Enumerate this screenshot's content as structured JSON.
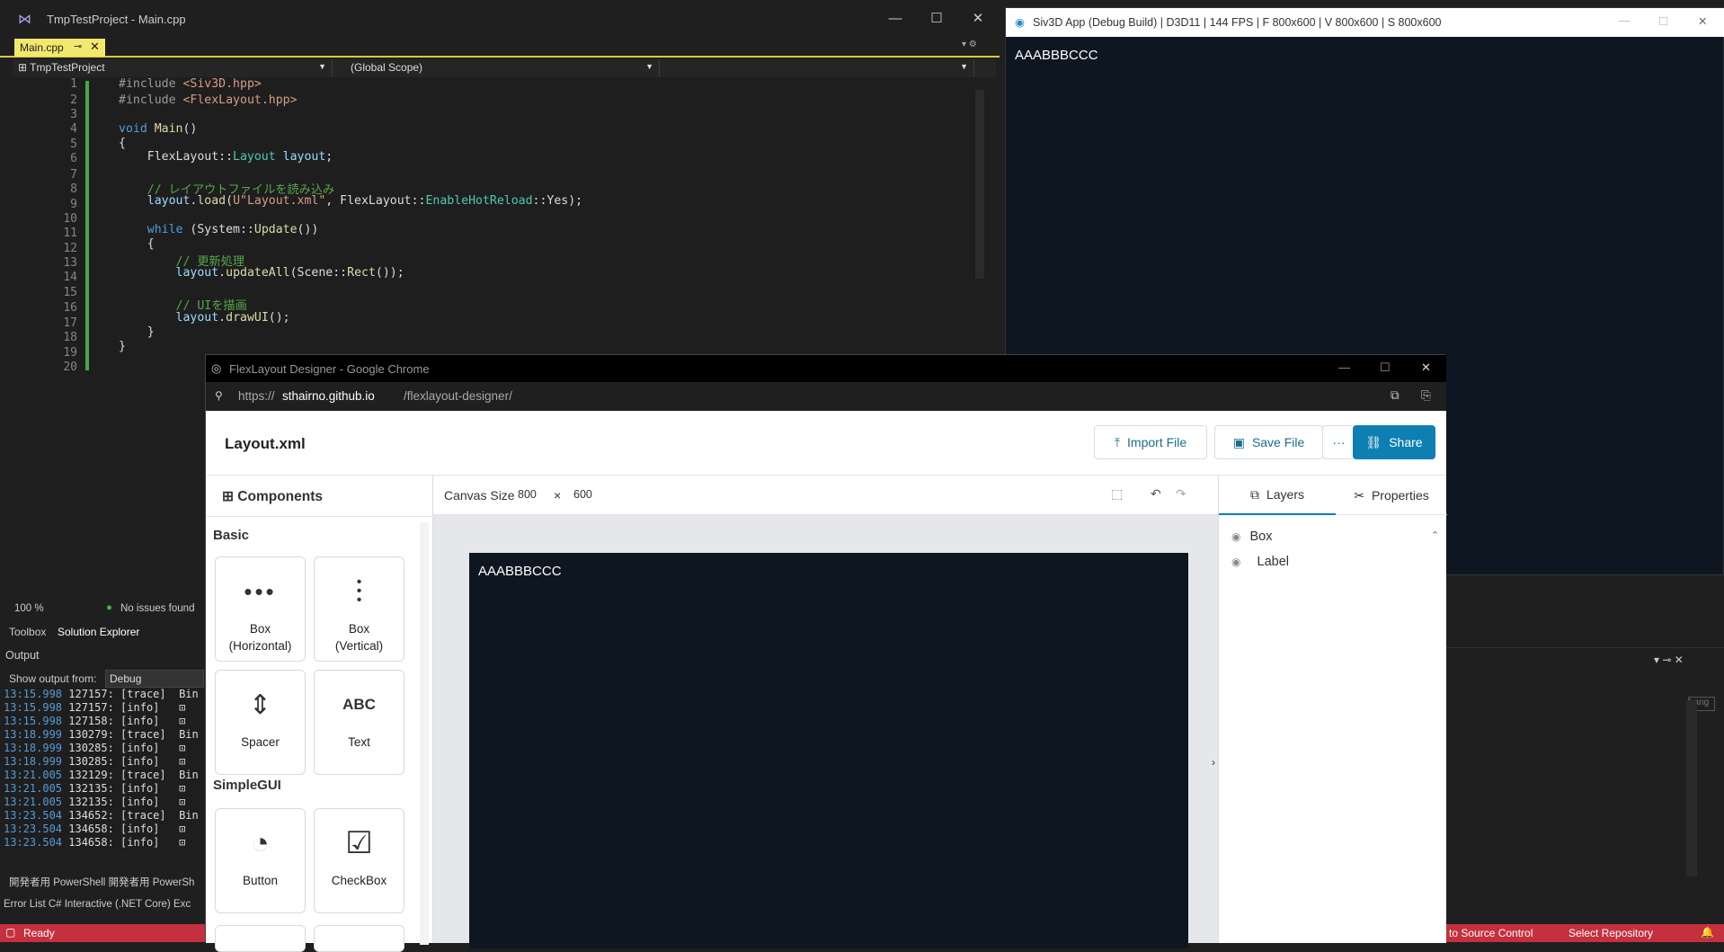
{
  "vs": {
    "title": "TmpTestProject - Main.cpp",
    "tab": "Main.cpp",
    "project_select": "TmpTestProject",
    "scope_select": "(Global Scope)",
    "zoom": "100 %",
    "issues": "No issues found",
    "dock_tab_toolbox": "Toolbox",
    "dock_tab_solution": "Solution Explorer",
    "output_title": "Output",
    "output_from_label": "Show output from:",
    "output_from_value": "Debug",
    "bottom_tabs_row1": "開発者用 PowerShell    開発者用 PowerSh",
    "bottom_tabs_row2": "Error List    C# Interactive (.NET Core)    Exc",
    "status_ready": "Ready",
    "status_source_control": "d to Source Control",
    "status_select_repo": "Select Repository",
    "code_lines": [
      "1",
      "2",
      "3",
      "4",
      "5",
      "6",
      "7",
      "8",
      "9",
      "10",
      "11",
      "12",
      "13",
      "14",
      "15",
      "16",
      "17",
      "18",
      "19",
      "20"
    ],
    "log": [
      [
        "13:15.998",
        "127157:",
        "[trace]",
        "Bin"
      ],
      [
        "13:15.998",
        "127157:",
        "[info]",
        "⊡"
      ],
      [
        "13:15.998",
        "127158:",
        "[info]",
        "⊡"
      ],
      [
        "13:18.999",
        "130279:",
        "[trace]",
        "Bin"
      ],
      [
        "13:18.999",
        "130285:",
        "[info]",
        "⊡"
      ],
      [
        "13:18.999",
        "130285:",
        "[info]",
        "⊡"
      ],
      [
        "13:21.005",
        "132129:",
        "[trace]",
        "Bin"
      ],
      [
        "13:21.005",
        "132135:",
        "[info]",
        "⊡"
      ],
      [
        "13:21.005",
        "132135:",
        "[info]",
        "⊡"
      ],
      [
        "13:23.504",
        "134652:",
        "[trace]",
        "Bin"
      ],
      [
        "13:23.504",
        "134658:",
        "[info]",
        "⊡"
      ],
      [
        "13:23.504",
        "134658:",
        "[info]",
        "⊡"
      ]
    ]
  },
  "siv": {
    "title": "Siv3D App (Debug Build) | D3D11 | 144 FPS | F 800x600 | V 800x600 | S 800x600",
    "text": "AAABBBCCC"
  },
  "chrome": {
    "title": "FlexLayout Designer - Google Chrome",
    "url_prefix": "https://",
    "url_host": "sthairno.github.io",
    "url_path": "/flexlayout-designer/"
  },
  "app": {
    "file_title": "Layout.xml",
    "import_label": "Import File",
    "save_label": "Save File",
    "more_label": "···",
    "share_label": "Share",
    "components_title": "Components",
    "section_basic": "Basic",
    "section_simplegui": "SimpleGUI",
    "cards": [
      {
        "label": "Box\n(Horizontal)"
      },
      {
        "label": "Box\n(Vertical)"
      },
      {
        "label": "Spacer"
      },
      {
        "label": "Text"
      },
      {
        "label": "Button"
      },
      {
        "label": "CheckBox"
      }
    ],
    "canvas_size_label": "Canvas Size",
    "canvas_w": "800",
    "canvas_x": "×",
    "canvas_h": "600",
    "canvas_text": "AAABBBCCC",
    "tab_layers": "Layers",
    "tab_properties": "Properties",
    "layer_box": "Box",
    "layer_label": "Label"
  },
  "colors": {
    "accent": "#0e7fb3",
    "vs_status": "#c5303f",
    "canvas_bg": "#0e1621",
    "tab_yellow": "#f2e86d"
  }
}
